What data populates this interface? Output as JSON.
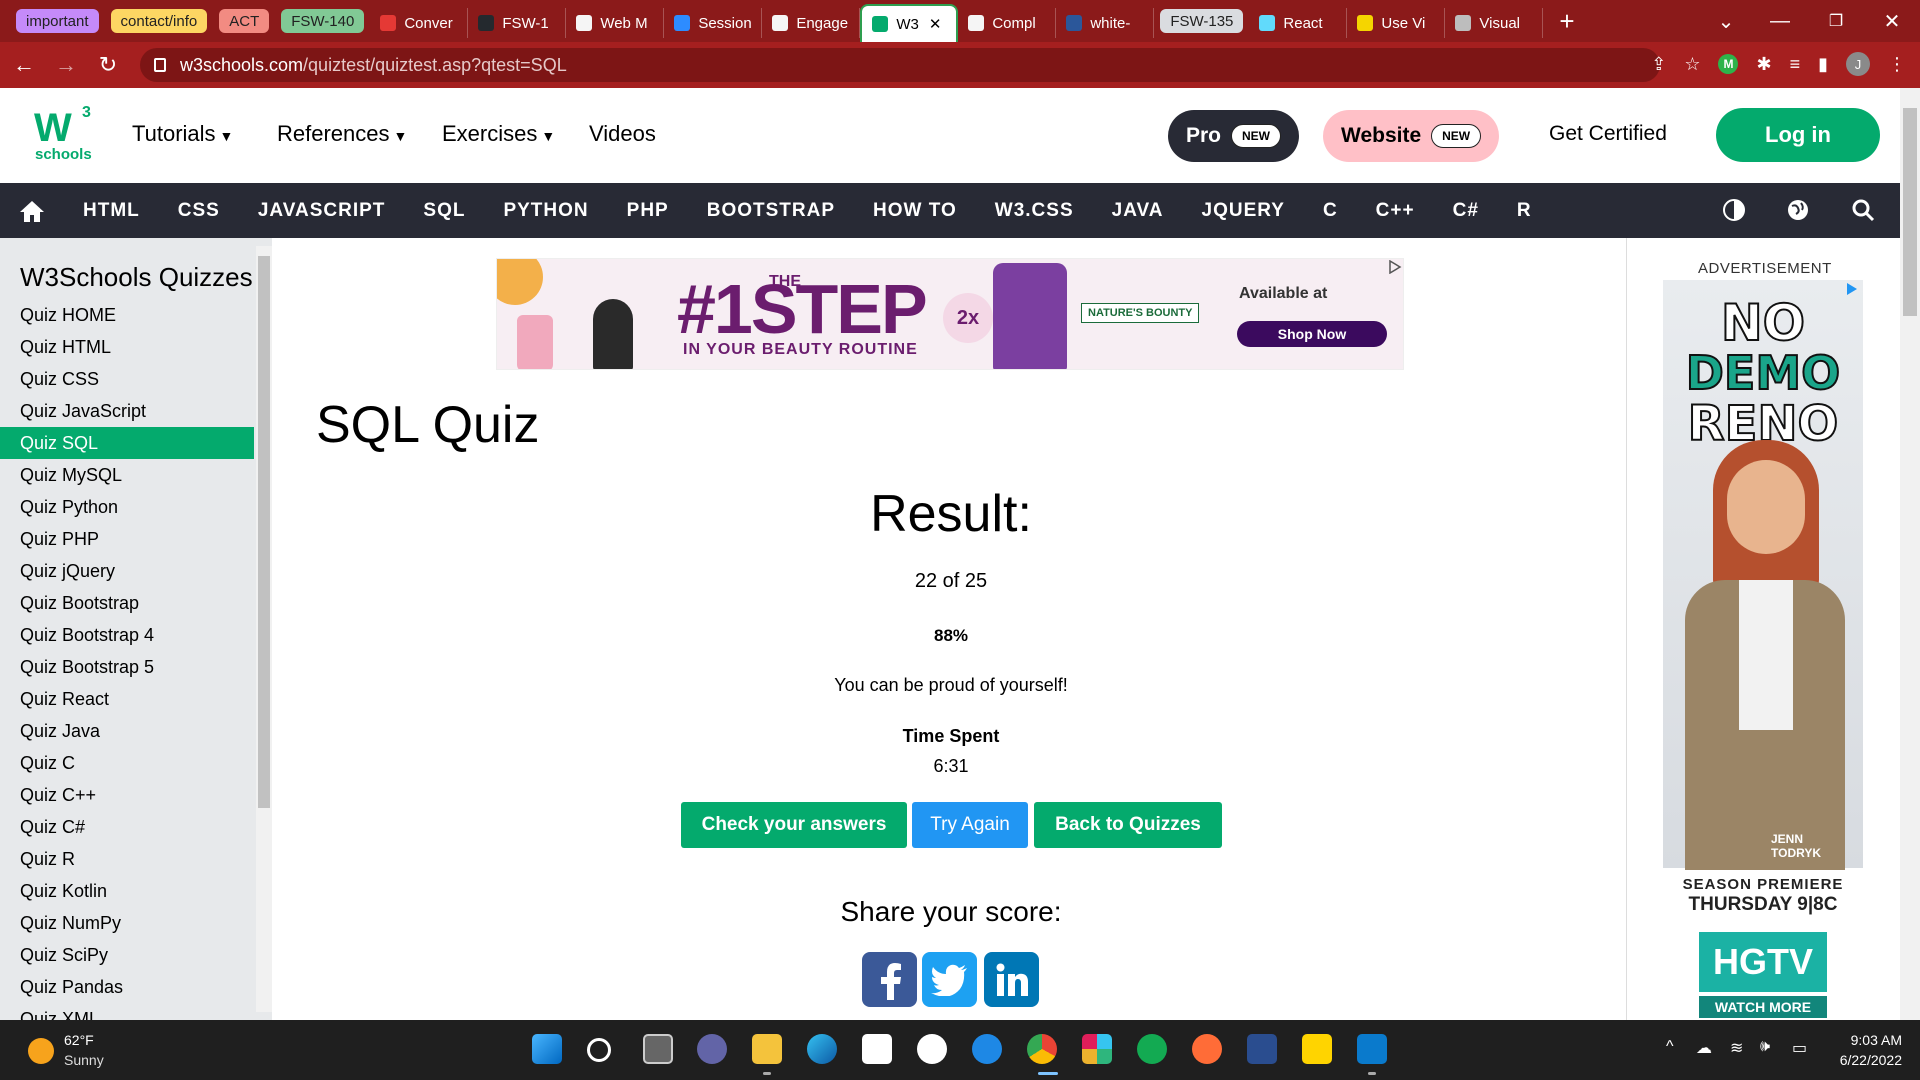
{
  "browser": {
    "tabs": [
      {
        "label": "important",
        "group": true,
        "color": "#c58af9",
        "w": 90
      },
      {
        "label": "contact/info",
        "group": true,
        "color": "#fdd663",
        "w": 104
      },
      {
        "label": "ACT",
        "group": true,
        "color": "#f28b82",
        "w": 50
      },
      {
        "label": "FSW-140",
        "group": true,
        "color": "#81c995",
        "w": 76
      },
      {
        "label": "Conver",
        "group": false,
        "favcolor": "#e53935",
        "w": 98
      },
      {
        "label": "FSW-1",
        "group": false,
        "favcolor": "#24292e",
        "w": 98
      },
      {
        "label": "Web M",
        "group": false,
        "favcolor": "#f5f5f5",
        "w": 98
      },
      {
        "label": "Session",
        "group": false,
        "favcolor": "#2d8cff",
        "w": 98
      },
      {
        "label": "Engage",
        "group": false,
        "favcolor": "#f5f5f5",
        "w": 98
      },
      {
        "label": "W3",
        "group": false,
        "favcolor": "#04aa6d",
        "w": 98,
        "active": true
      },
      {
        "label": "Compl",
        "group": false,
        "favcolor": "#f5f5f5",
        "w": 98
      },
      {
        "label": "white-",
        "group": false,
        "favcolor": "#2b579a",
        "w": 98
      },
      {
        "label": "FSW-135",
        "group": true,
        "color": "#dadce0",
        "w": 80
      },
      {
        "label": "React",
        "group": false,
        "favcolor": "#61dafb",
        "w": 98
      },
      {
        "label": "Use Vi",
        "group": false,
        "favcolor": "#f5d500",
        "w": 98
      },
      {
        "label": "Visual",
        "group": false,
        "favcolor": "#bdbdbd",
        "w": 98
      }
    ],
    "url_host": "w3schools.com",
    "url_path": "/quiztest/quiztest.asp?qtest=SQL"
  },
  "header": {
    "logo_letter": "W",
    "logo_sup": "3",
    "logo_text": "schools",
    "nav": [
      "Tutorials",
      "References",
      "Exercises",
      "Videos"
    ],
    "pro": "Pro",
    "website": "Website",
    "new_badge": "NEW",
    "get_certified": "Get Certified",
    "login": "Log in"
  },
  "topics": [
    "HTML",
    "CSS",
    "JAVASCRIPT",
    "SQL",
    "PYTHON",
    "PHP",
    "BOOTSTRAP",
    "HOW TO",
    "W3.CSS",
    "JAVA",
    "JQUERY",
    "C",
    "C++",
    "C#",
    "R"
  ],
  "sidebar": {
    "title": "W3Schools Quizzes",
    "items": [
      "Quiz HOME",
      "Quiz HTML",
      "Quiz CSS",
      "Quiz JavaScript",
      "Quiz SQL",
      "Quiz MySQL",
      "Quiz Python",
      "Quiz PHP",
      "Quiz jQuery",
      "Quiz Bootstrap",
      "Quiz Bootstrap 4",
      "Quiz Bootstrap 5",
      "Quiz React",
      "Quiz Java",
      "Quiz C",
      "Quiz C++",
      "Quiz C#",
      "Quiz R",
      "Quiz Kotlin",
      "Quiz NumPy",
      "Quiz SciPy",
      "Quiz Pandas",
      "Quiz XML"
    ],
    "active_index": 4
  },
  "ad_banner": {
    "the": "THE",
    "headline": "#1STEP",
    "tagline": "IN YOUR BEAUTY ROUTINE",
    "badge": "2x",
    "brand": "NATURE'S BOUNTY",
    "available": "Available at",
    "shop": "Shop Now"
  },
  "main": {
    "page_title": "SQL Quiz",
    "result_heading": "Result:",
    "score": "22 of 25",
    "percent": "88%",
    "praise": "You can be proud of yourself!",
    "time_label": "Time Spent",
    "time_value": "6:31",
    "buttons": {
      "check": "Check your answers",
      "try": "Try Again",
      "back": "Back to Quizzes"
    },
    "share_label": "Share your score:"
  },
  "side_ad": {
    "label": "ADVERTISEMENT",
    "line1": "NO",
    "line2": "DEMO",
    "line3": "RENO",
    "person": "JENN\nTODRYK",
    "season": "SEASON PREMIERE",
    "thursday": "THURSDAY 9|8C",
    "network": "HGTV",
    "watch": "WATCH MORE"
  },
  "taskbar": {
    "temp": "62°F",
    "condition": "Sunny",
    "time": "9:03 AM",
    "date": "6/22/2022"
  }
}
